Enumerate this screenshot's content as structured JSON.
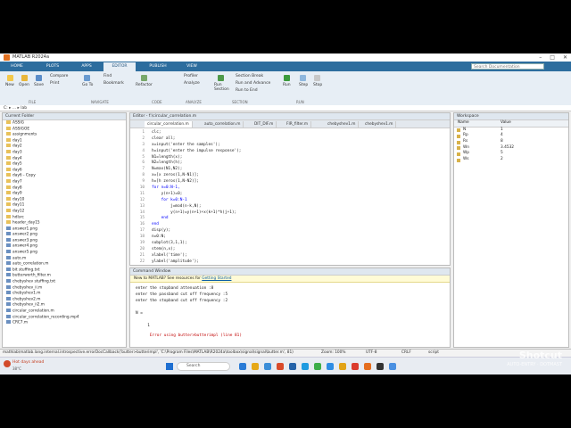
{
  "window": {
    "title": "MATLAB R2024a"
  },
  "tabs": [
    "HOME",
    "PLOTS",
    "APPS",
    "EDITOR",
    "PUBLISH",
    "VIEW"
  ],
  "active_tab": "EDITOR",
  "search_placeholder": "Search Documentation",
  "ribbon": {
    "file": [
      "New",
      "Open",
      "Save"
    ],
    "file_extra": [
      "Compare",
      "Print"
    ],
    "navigate": [
      "Go To",
      "Find",
      "Bookmark"
    ],
    "code": [
      "Refactor"
    ],
    "analyze": [
      "Profiler",
      "Analyze"
    ],
    "section": [
      "Run Section",
      "Section Break",
      "Run and Advance",
      "Run to End"
    ],
    "run": [
      "Run",
      "Step",
      "Stop"
    ],
    "group_names": [
      "FILE",
      "NAVIGATE",
      "CODE",
      "ANALYZE",
      "SECTION",
      "RUN"
    ]
  },
  "address": "C: ▸ ... ▸ lab",
  "current_folder": {
    "header": "Current Folder",
    "items": [
      "ASSIG",
      "ASSIGOE",
      "assignments",
      "day1",
      "day2",
      "day3",
      "day4",
      "day5",
      "day6",
      "day6 - Copy",
      "day7",
      "day8",
      "day9",
      "day10",
      "day11",
      "day12",
      "hdlsrc",
      "header_day15",
      "answer1.png",
      "answer2.png",
      "answer3.png",
      "answer4.png",
      "answer5.png",
      "auto.m",
      "auto_correlation.m",
      "bit stuffing.txt",
      "butterworth_filter.m",
      "chebyshev stuffing.txt",
      "chebyshev_ii.m",
      "chebyshev1.m",
      "chebyshev2.m",
      "chebyshev_ii2.m",
      "circular_correlation.m",
      "circular_correlation_recording.mp4",
      "CRC7.m"
    ]
  },
  "editor": {
    "header": "Editor - f:\\circular_correlation.m",
    "tabs": [
      "circular_correlation.m",
      "auto_correlation.m",
      "DIT_DIF.m",
      "FIR_filter.m",
      "chebyshev1.m",
      "chebyshev1.m"
    ],
    "lines": [
      "clc;",
      "clear all;",
      "x=input('enter the samples');",
      "h=input('enter the impulse response');",
      "N1=length(x);",
      "N2=length(h);",
      "N=max(N1,N2);",
      "x=[x zeros(1,N-N1)];",
      "h=[h zeros(1,N-N2)];",
      "for n=0:N-1,",
      "    y(n+1)=0;",
      "    for k=0:N-1",
      "        j=mod(n-k,N);",
      "        y(n+1)=y(n+1)+x(k+1)*h(j+1);",
      "    end",
      "end",
      "disp(y);",
      "n=0:N;",
      "subplot(3,1,1);",
      "stem(n,x);",
      "xlabel('time');",
      "ylabel('amplitude');",
      "subplot(3,1,2);"
    ]
  },
  "command_window": {
    "header": "Command Window",
    "notice": "New to MATLAB? See resources for",
    "notice_link": "Getting Started",
    "lines": [
      "enter the stopband attenuation :8",
      "enter the passband cut off frequency :5",
      "enter the stopband cut off frequency :2",
      "",
      "N =",
      "",
      "     1"
    ],
    "error": "Error using butter>butterimpl (line 81)"
  },
  "workspace": {
    "header": "Workspace",
    "col_name": "Name",
    "col_value": "Value",
    "rows": [
      {
        "name": "N",
        "value": "1"
      },
      {
        "name": "Rp",
        "value": "4"
      },
      {
        "name": "Rs",
        "value": "8"
      },
      {
        "name": "Wn",
        "value": "3.4532"
      },
      {
        "name": "Wp",
        "value": "5"
      },
      {
        "name": "Ws",
        "value": "2"
      }
    ]
  },
  "status": {
    "left": "mathlab\\matlab.lang.internal.introspective.errorDocCallback('butter>butterimpl', 'C:\\Program Files\\MATLAB\\R2024a\\toolbox\\signal\\signal\\butter.m', 81)",
    "zoom": "Zoom: 100%",
    "encoding": "UTF-8",
    "eol": "CRLF",
    "type": "script"
  },
  "taskbar": {
    "weather": "Hot days ahead",
    "weather_sub": "38°C",
    "search": "Search"
  },
  "watermark": {
    "brand": "Shotcut",
    "sub": "AUTO-ENTRY · DOTMAST"
  },
  "colors": {
    "tabstrip": "#2d6d9e",
    "ribbon": "#e7eef5",
    "error": "#c00000",
    "link": "#0b5fa5",
    "keyword": "#0000ff",
    "string": "#a020f0"
  }
}
